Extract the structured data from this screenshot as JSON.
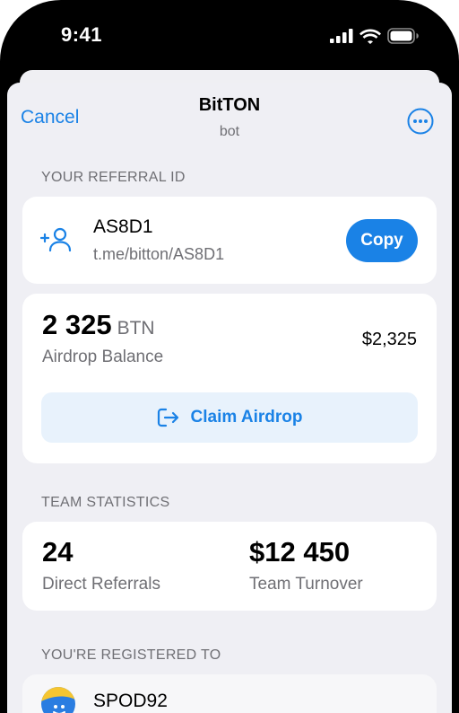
{
  "status_bar": {
    "time": "9:41"
  },
  "nav": {
    "cancel_label": "Cancel",
    "title": "BitTON",
    "subtitle": "bot"
  },
  "referral": {
    "section_label": "YOUR REFERRAL ID",
    "id": "AS8D1",
    "link": "t.me/bitton/AS8D1",
    "copy_label": "Copy"
  },
  "balance": {
    "amount": "2 325",
    "unit": "BTN",
    "label": "Airdrop Balance",
    "usd_value": "$2,325",
    "claim_label": "Claim Airdrop"
  },
  "team": {
    "section_label": "TEAM STATISTICS",
    "direct_referrals_value": "24",
    "direct_referrals_label": "Direct Referrals",
    "turnover_value": "$12 450",
    "turnover_label": "Team Turnover"
  },
  "registered": {
    "section_label": "YOU'RE REGISTERED TO",
    "name": "SPOD92"
  },
  "colors": {
    "accent": "#1a82e6",
    "claim_background": "#e8f2fc",
    "sheet_background": "#efeff4",
    "secondary_text": "#6f6f74"
  },
  "icons": {
    "signal": "cellular-signal-icon",
    "wifi": "wifi-icon",
    "battery": "battery-icon",
    "more": "more-ellipsis-icon",
    "add_user": "add-user-icon",
    "claim": "sign-out-arrow-icon",
    "avatar": "avatar-icon"
  }
}
